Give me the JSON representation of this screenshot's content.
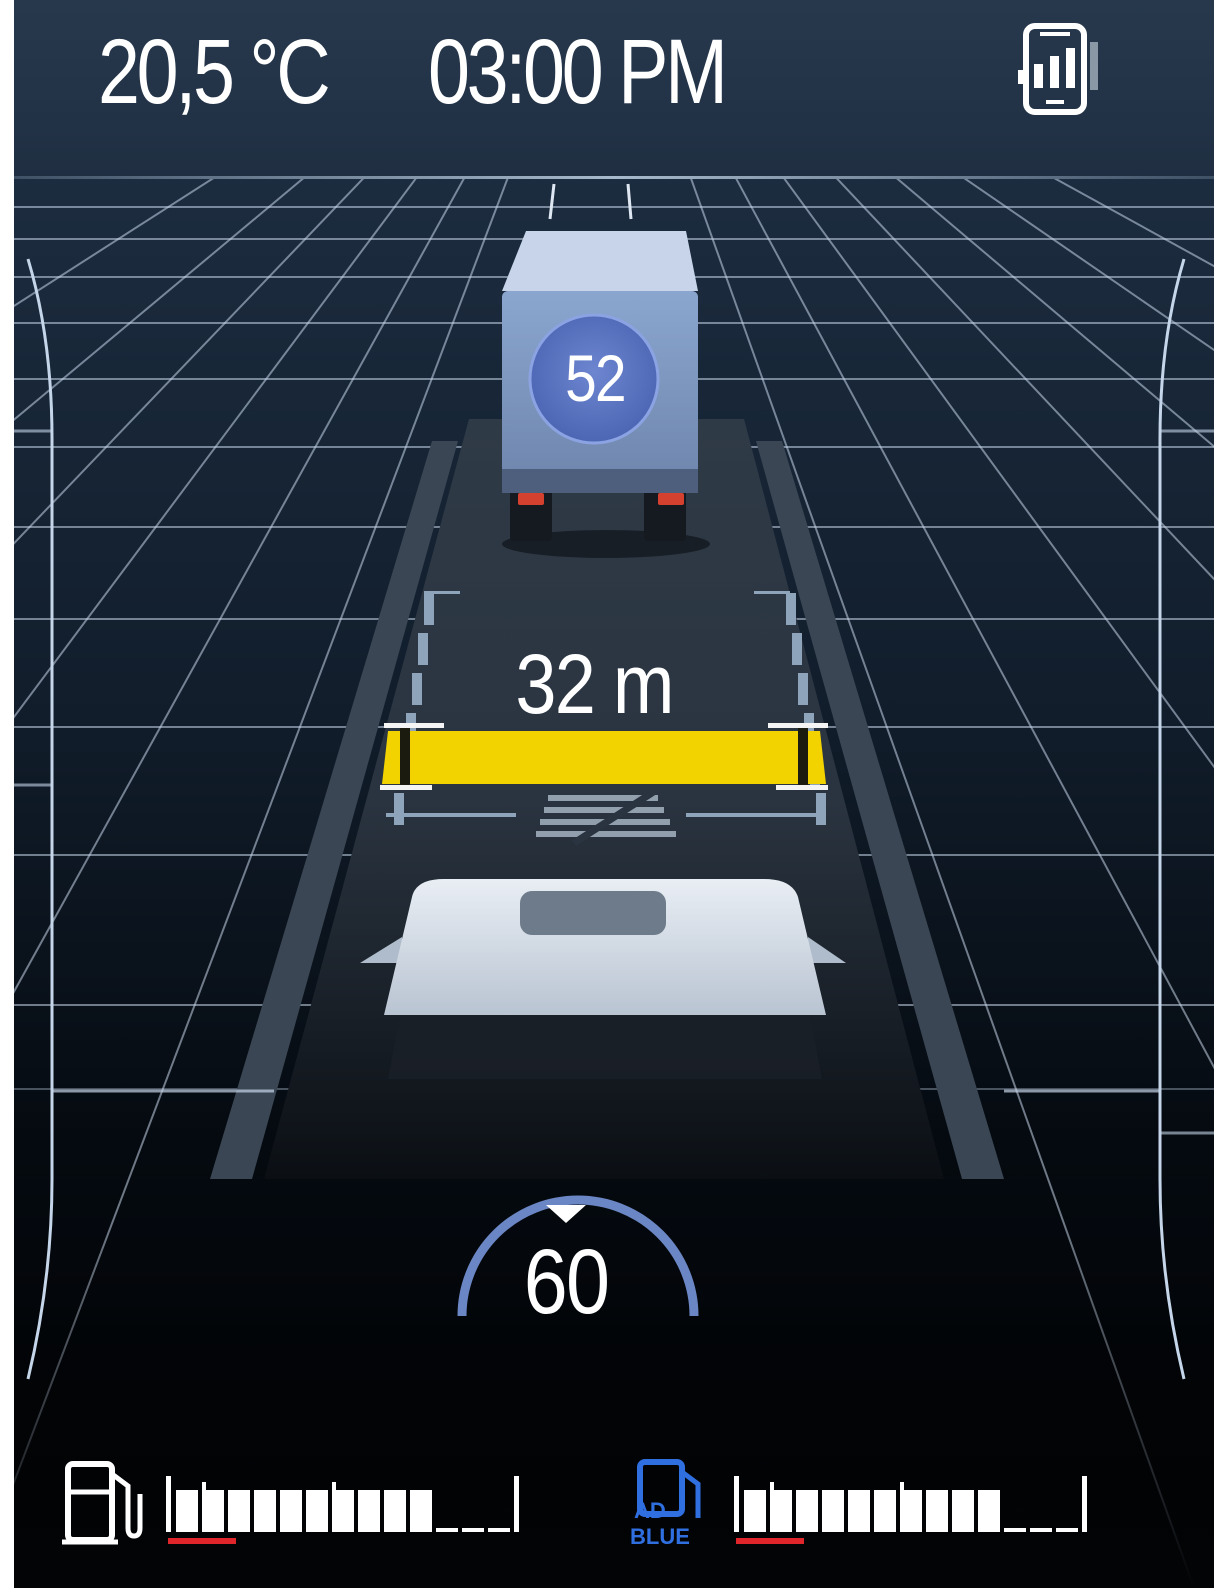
{
  "status_bar": {
    "temperature": "20,5 °C",
    "time": "03:00 PM",
    "phone_icon": "phone-signal-icon"
  },
  "lead_vehicle": {
    "type": "truck",
    "speed": "52"
  },
  "following_distance": {
    "value": "32 m",
    "zone_color": "#f2d300"
  },
  "ego_vehicle": {
    "set_speed": "60"
  },
  "gauges": {
    "fuel": {
      "icon": "fuel-pump-icon",
      "level_fraction": 0.125,
      "segments_filled": 10,
      "segments_total": 13
    },
    "adblue": {
      "icon": "adblue-icon",
      "icon_text_line1": "AD",
      "icon_text_line2": "BLUE",
      "level_fraction": 0.125,
      "segments_filled": 10,
      "segments_total": 13
    }
  },
  "colors": {
    "accent_blue": "#5f7fc0",
    "adblue_blue": "#2f6fe0",
    "warning_red": "#e0262a",
    "zone_yellow": "#f2d300"
  }
}
